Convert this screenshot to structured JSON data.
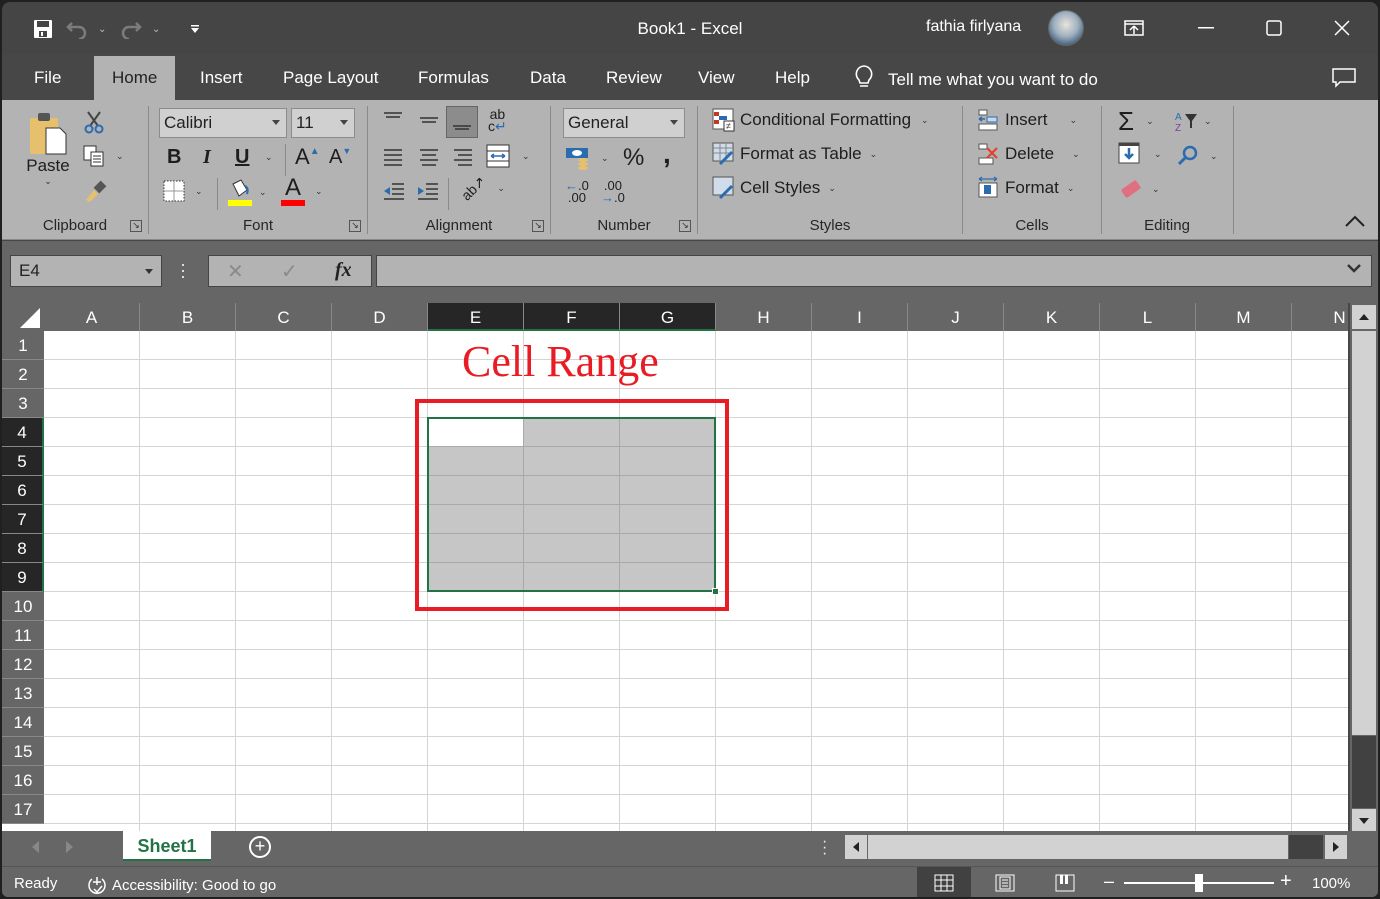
{
  "window": {
    "title": "Book1  -  Excel",
    "user_name": "fathia firlyana"
  },
  "quick_access": {
    "save": "save-icon",
    "undo": "undo-icon",
    "redo": "redo-icon",
    "customize": "customize-qat-icon"
  },
  "tabs": [
    {
      "label": "File"
    },
    {
      "label": "Home",
      "active": true
    },
    {
      "label": "Insert"
    },
    {
      "label": "Page Layout"
    },
    {
      "label": "Formulas"
    },
    {
      "label": "Data"
    },
    {
      "label": "Review"
    },
    {
      "label": "View"
    },
    {
      "label": "Help"
    }
  ],
  "tell_me": "Tell me what you want to do",
  "ribbon": {
    "clipboard": {
      "label": "Clipboard",
      "paste": "Paste"
    },
    "font": {
      "label": "Font",
      "font_name": "Calibri",
      "font_size": "11",
      "bold": "B",
      "italic": "I",
      "underline": "U",
      "grow": "A",
      "shrink": "A",
      "font_color": "A",
      "highlight_color": "#ffff00",
      "text_color": "#ff0000"
    },
    "alignment": {
      "label": "Alignment",
      "wrap": "ab"
    },
    "number": {
      "label": "Number",
      "format": "General",
      "percent": "%",
      "comma": ",",
      "inc_decimal_top": ".0",
      "inc_decimal_bottom": ".00",
      "dec_decimal_top": ".00",
      "dec_decimal_bottom": ".0"
    },
    "styles": {
      "label": "Styles",
      "conditional": "Conditional Formatting",
      "format_table": "Format as Table",
      "cell_styles": "Cell Styles"
    },
    "cells": {
      "label": "Cells",
      "insert": "Insert",
      "delete": "Delete",
      "format": "Format"
    },
    "editing": {
      "label": "Editing",
      "sum": "Σ"
    }
  },
  "formula_bar": {
    "name_box": "E4",
    "cancel": "✕",
    "enter": "✓",
    "fx": "fx",
    "value": ""
  },
  "sheet": {
    "columns": [
      "A",
      "B",
      "C",
      "D",
      "E",
      "F",
      "G",
      "H",
      "I",
      "J",
      "K",
      "L",
      "M",
      "N"
    ],
    "rows": [
      "1",
      "2",
      "3",
      "4",
      "5",
      "6",
      "7",
      "8",
      "9",
      "10",
      "11",
      "12",
      "13",
      "14",
      "15",
      "16",
      "17"
    ],
    "selected_columns": [
      "E",
      "F",
      "G"
    ],
    "selected_rows": [
      "4",
      "5",
      "6",
      "7",
      "8",
      "9"
    ],
    "selection_range": "E4:G9",
    "active_cell": "E4",
    "selection_color": "#217346"
  },
  "annotation": {
    "text": "Cell Range",
    "color": "#e81c24"
  },
  "sheet_tabs": [
    {
      "label": "Sheet1",
      "active": true
    }
  ],
  "status": {
    "ready": "Ready",
    "accessibility": "Accessibility: Good to go",
    "zoom_level": "100%",
    "zoom_fraction": 0.5
  }
}
